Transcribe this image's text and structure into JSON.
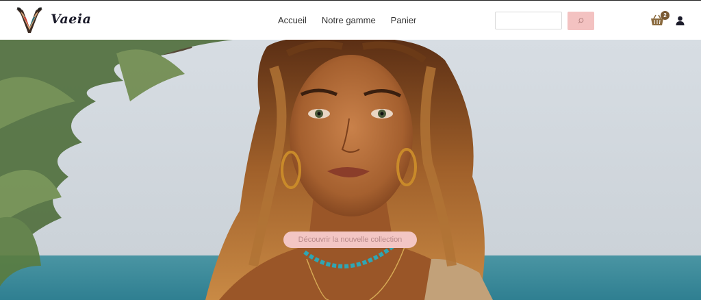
{
  "brand": {
    "name": "Vaeia",
    "logo_icon": "v-letter-logo"
  },
  "nav": {
    "items": [
      {
        "label": "Accueil"
      },
      {
        "label": "Notre gamme"
      },
      {
        "label": "Panier"
      }
    ]
  },
  "search": {
    "placeholder": "",
    "value": "",
    "button_icon": "search-icon"
  },
  "cart": {
    "icon": "basket-icon",
    "count": "2"
  },
  "account": {
    "icon": "user-icon"
  },
  "hero": {
    "cta_label": "Découvrir la nouvelle collection"
  },
  "colors": {
    "accent_pink": "#f3c2c1",
    "badge_brown": "#7a5a33",
    "sea": "#3d8a9a",
    "sky": "#cfd6dd"
  }
}
